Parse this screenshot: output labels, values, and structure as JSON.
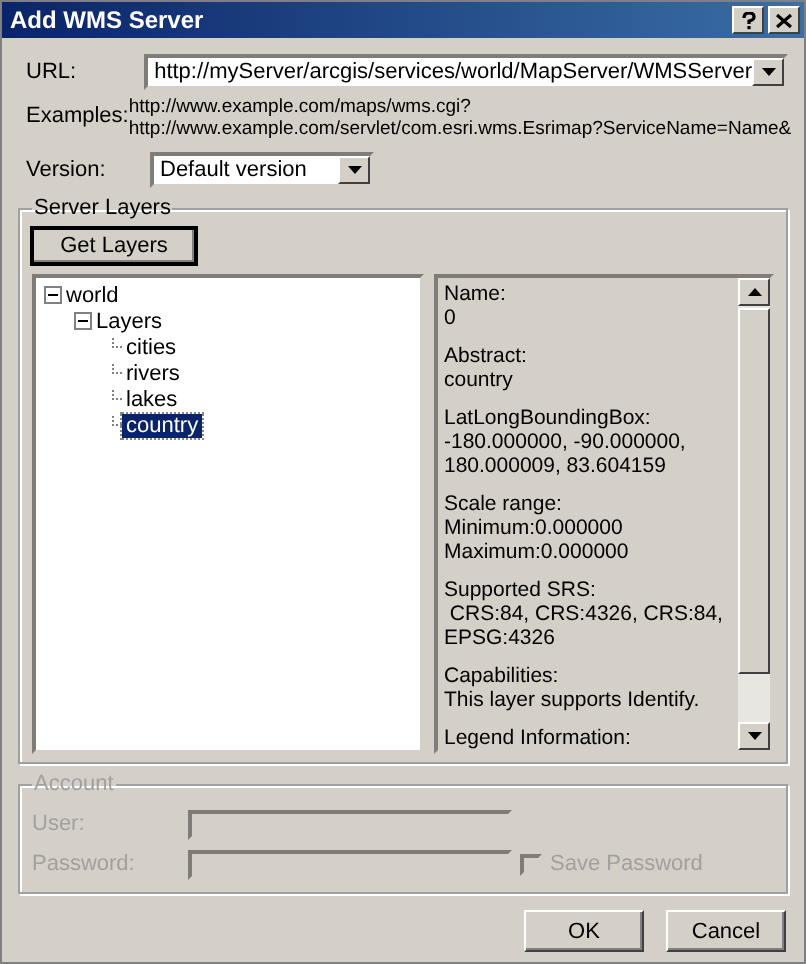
{
  "window": {
    "title": "Add WMS Server"
  },
  "url": {
    "label": "URL:",
    "value": "http://myServer/arcgis/services/world/MapServer/WMSServer"
  },
  "examples": {
    "label": "Examples:",
    "lines": [
      "http://www.example.com/maps/wms.cgi?",
      "http://www.example.com/servlet/com.esri.wms.Esrimap?ServiceName=Name&"
    ]
  },
  "version": {
    "label": "Version:",
    "value": "Default version"
  },
  "server_layers": {
    "title": "Server Layers",
    "get_layers_button": "Get Layers",
    "tree": [
      {
        "label": "world",
        "expanded": true,
        "selected": false,
        "children": [
          {
            "label": "Layers",
            "expanded": true,
            "selected": false,
            "children": [
              {
                "label": "cities",
                "selected": false
              },
              {
                "label": "rivers",
                "selected": false
              },
              {
                "label": "lakes",
                "selected": false
              },
              {
                "label": "country",
                "selected": true
              }
            ]
          }
        ]
      }
    ],
    "details": [
      {
        "heading": "Name:",
        "lines": [
          "0"
        ]
      },
      {
        "heading": "Abstract:",
        "lines": [
          "country"
        ]
      },
      {
        "heading": "LatLongBoundingBox:",
        "lines": [
          "-180.000000, -90.000000,",
          "180.000009, 83.604159"
        ]
      },
      {
        "heading": "Scale range:",
        "lines": [
          "Minimum:0.000000",
          "Maximum:0.000000"
        ]
      },
      {
        "heading": "Supported SRS:",
        "lines": [
          " CRS:84, CRS:4326, CRS:84,",
          "EPSG:4326"
        ]
      },
      {
        "heading": "Capabilities:",
        "lines": [
          "This layer supports Identify."
        ]
      },
      {
        "heading": "Legend Information:"
      }
    ]
  },
  "account": {
    "title": "Account",
    "disabled": true,
    "user_label": "User:",
    "password_label": "Password:",
    "save_password": {
      "label": "Save Password",
      "checked": false
    }
  },
  "buttons": [
    "OK",
    "Cancel"
  ]
}
